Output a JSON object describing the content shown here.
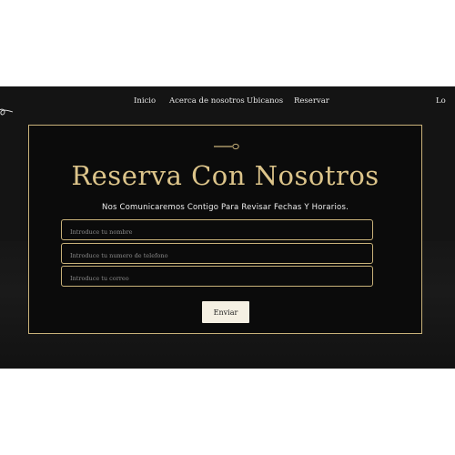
{
  "nav": {
    "items": [
      {
        "label": "Inicio"
      },
      {
        "label": "Acerca de nosotros"
      },
      {
        "label": "Ubicanos"
      },
      {
        "label": "Reservar"
      },
      {
        "label": "Lo"
      }
    ]
  },
  "hero": {
    "title": "Reserva Con Nosotros",
    "subtitle": "Nos Comunicaremos Contigo Para Revisar Fechas Y Horarios."
  },
  "form": {
    "name_placeholder": "Introduce tu nombre",
    "phone_placeholder": "Introduce tu numero de telefono",
    "email_placeholder": "Introduce tu correo",
    "submit_label": "Enviar"
  },
  "colors": {
    "accent": "#c9b27a",
    "title": "#dcc48a",
    "background": "#141414"
  }
}
